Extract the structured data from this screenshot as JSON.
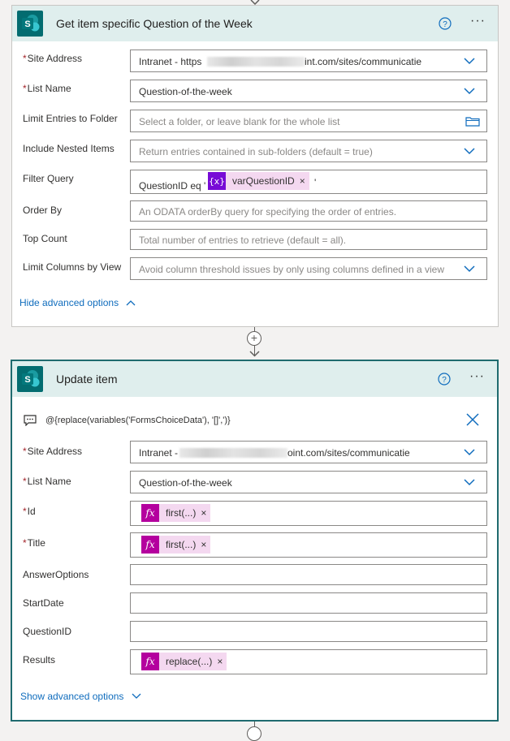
{
  "action1": {
    "title": "Get item specific Question of the Week",
    "icon": "sharepoint-icon",
    "rows": {
      "site_address": {
        "label": "Site Address",
        "required": "*",
        "value_start": "Intranet - https",
        "value_end": "int.com/sites/communicatie"
      },
      "list_name": {
        "label": "List Name",
        "required": "*",
        "value": "Question-of-the-week"
      },
      "limit_folder": {
        "label": "Limit Entries to Folder",
        "placeholder": "Select a folder, or leave blank for the whole list"
      },
      "nested_items": {
        "label": "Include Nested Items",
        "placeholder": "Return entries contained in sub-folders (default = true)"
      },
      "filter_query": {
        "label": "Filter Query",
        "prefix": "QuestionID eq '",
        "token": "varQuestionID",
        "token_icon": "{x}",
        "suffix": "'"
      },
      "order_by": {
        "label": "Order By",
        "placeholder": "An ODATA orderBy query for specifying the order of entries."
      },
      "top_count": {
        "label": "Top Count",
        "placeholder": "Total number of entries to retrieve (default = all)."
      },
      "limit_columns": {
        "label": "Limit Columns by View",
        "placeholder": "Avoid column threshold issues by only using columns defined in a view"
      }
    },
    "advanced_link": "Hide advanced options"
  },
  "action2": {
    "title": "Update item",
    "icon": "sharepoint-icon",
    "comment": "@{replace(variables('FormsChoiceData'), '[]',')}",
    "rows": {
      "site_address": {
        "label": "Site Address",
        "required": "*",
        "value_start": "Intranet - ",
        "value_end": "oint.com/sites/communicatie"
      },
      "list_name": {
        "label": "List Name",
        "required": "*",
        "value": "Question-of-the-week"
      },
      "id": {
        "label": "Id",
        "required": "*",
        "token": "first(...)",
        "token_icon": "fx"
      },
      "title": {
        "label": "Title",
        "required": "*",
        "token": "first(...)",
        "token_icon": "fx"
      },
      "answer_options": {
        "label": "AnswerOptions"
      },
      "start_date": {
        "label": "StartDate"
      },
      "question_id": {
        "label": "QuestionID"
      },
      "results": {
        "label": "Results",
        "token": "replace(...)",
        "token_icon": "fx"
      }
    },
    "advanced_link": "Show advanced options"
  },
  "connector": {
    "plus": "+"
  },
  "colors": {
    "header_bg": "#dfeeed",
    "sharepoint": "#036c70",
    "fx_token": "#b4009e",
    "var_token": "#770bd6",
    "link": "#0f6cbd",
    "required": "#a4262c"
  }
}
